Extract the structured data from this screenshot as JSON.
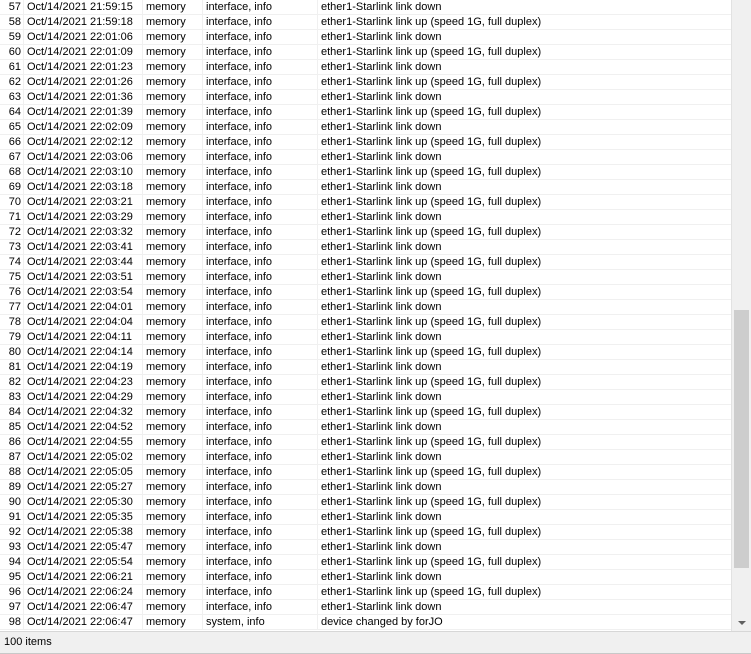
{
  "log": {
    "rows": [
      {
        "num": "57",
        "time": "Oct/14/2021 21:59:15",
        "buffer": "memory",
        "topics": "interface, info",
        "message": "ether1-Starlink link down"
      },
      {
        "num": "58",
        "time": "Oct/14/2021 21:59:18",
        "buffer": "memory",
        "topics": "interface, info",
        "message": "ether1-Starlink link up (speed 1G, full duplex)"
      },
      {
        "num": "59",
        "time": "Oct/14/2021 22:01:06",
        "buffer": "memory",
        "topics": "interface, info",
        "message": "ether1-Starlink link down"
      },
      {
        "num": "60",
        "time": "Oct/14/2021 22:01:09",
        "buffer": "memory",
        "topics": "interface, info",
        "message": "ether1-Starlink link up (speed 1G, full duplex)"
      },
      {
        "num": "61",
        "time": "Oct/14/2021 22:01:23",
        "buffer": "memory",
        "topics": "interface, info",
        "message": "ether1-Starlink link down"
      },
      {
        "num": "62",
        "time": "Oct/14/2021 22:01:26",
        "buffer": "memory",
        "topics": "interface, info",
        "message": "ether1-Starlink link up (speed 1G, full duplex)"
      },
      {
        "num": "63",
        "time": "Oct/14/2021 22:01:36",
        "buffer": "memory",
        "topics": "interface, info",
        "message": "ether1-Starlink link down"
      },
      {
        "num": "64",
        "time": "Oct/14/2021 22:01:39",
        "buffer": "memory",
        "topics": "interface, info",
        "message": "ether1-Starlink link up (speed 1G, full duplex)"
      },
      {
        "num": "65",
        "time": "Oct/14/2021 22:02:09",
        "buffer": "memory",
        "topics": "interface, info",
        "message": "ether1-Starlink link down"
      },
      {
        "num": "66",
        "time": "Oct/14/2021 22:02:12",
        "buffer": "memory",
        "topics": "interface, info",
        "message": "ether1-Starlink link up (speed 1G, full duplex)"
      },
      {
        "num": "67",
        "time": "Oct/14/2021 22:03:06",
        "buffer": "memory",
        "topics": "interface, info",
        "message": "ether1-Starlink link down"
      },
      {
        "num": "68",
        "time": "Oct/14/2021 22:03:10",
        "buffer": "memory",
        "topics": "interface, info",
        "message": "ether1-Starlink link up (speed 1G, full duplex)"
      },
      {
        "num": "69",
        "time": "Oct/14/2021 22:03:18",
        "buffer": "memory",
        "topics": "interface, info",
        "message": "ether1-Starlink link down"
      },
      {
        "num": "70",
        "time": "Oct/14/2021 22:03:21",
        "buffer": "memory",
        "topics": "interface, info",
        "message": "ether1-Starlink link up (speed 1G, full duplex)"
      },
      {
        "num": "71",
        "time": "Oct/14/2021 22:03:29",
        "buffer": "memory",
        "topics": "interface, info",
        "message": "ether1-Starlink link down"
      },
      {
        "num": "72",
        "time": "Oct/14/2021 22:03:32",
        "buffer": "memory",
        "topics": "interface, info",
        "message": "ether1-Starlink link up (speed 1G, full duplex)"
      },
      {
        "num": "73",
        "time": "Oct/14/2021 22:03:41",
        "buffer": "memory",
        "topics": "interface, info",
        "message": "ether1-Starlink link down"
      },
      {
        "num": "74",
        "time": "Oct/14/2021 22:03:44",
        "buffer": "memory",
        "topics": "interface, info",
        "message": "ether1-Starlink link up (speed 1G, full duplex)"
      },
      {
        "num": "75",
        "time": "Oct/14/2021 22:03:51",
        "buffer": "memory",
        "topics": "interface, info",
        "message": "ether1-Starlink link down"
      },
      {
        "num": "76",
        "time": "Oct/14/2021 22:03:54",
        "buffer": "memory",
        "topics": "interface, info",
        "message": "ether1-Starlink link up (speed 1G, full duplex)"
      },
      {
        "num": "77",
        "time": "Oct/14/2021 22:04:01",
        "buffer": "memory",
        "topics": "interface, info",
        "message": "ether1-Starlink link down"
      },
      {
        "num": "78",
        "time": "Oct/14/2021 22:04:04",
        "buffer": "memory",
        "topics": "interface, info",
        "message": "ether1-Starlink link up (speed 1G, full duplex)"
      },
      {
        "num": "79",
        "time": "Oct/14/2021 22:04:11",
        "buffer": "memory",
        "topics": "interface, info",
        "message": "ether1-Starlink link down"
      },
      {
        "num": "80",
        "time": "Oct/14/2021 22:04:14",
        "buffer": "memory",
        "topics": "interface, info",
        "message": "ether1-Starlink link up (speed 1G, full duplex)"
      },
      {
        "num": "81",
        "time": "Oct/14/2021 22:04:19",
        "buffer": "memory",
        "topics": "interface, info",
        "message": "ether1-Starlink link down"
      },
      {
        "num": "82",
        "time": "Oct/14/2021 22:04:23",
        "buffer": "memory",
        "topics": "interface, info",
        "message": "ether1-Starlink link up (speed 1G, full duplex)"
      },
      {
        "num": "83",
        "time": "Oct/14/2021 22:04:29",
        "buffer": "memory",
        "topics": "interface, info",
        "message": "ether1-Starlink link down"
      },
      {
        "num": "84",
        "time": "Oct/14/2021 22:04:32",
        "buffer": "memory",
        "topics": "interface, info",
        "message": "ether1-Starlink link up (speed 1G, full duplex)"
      },
      {
        "num": "85",
        "time": "Oct/14/2021 22:04:52",
        "buffer": "memory",
        "topics": "interface, info",
        "message": "ether1-Starlink link down"
      },
      {
        "num": "86",
        "time": "Oct/14/2021 22:04:55",
        "buffer": "memory",
        "topics": "interface, info",
        "message": "ether1-Starlink link up (speed 1G, full duplex)"
      },
      {
        "num": "87",
        "time": "Oct/14/2021 22:05:02",
        "buffer": "memory",
        "topics": "interface, info",
        "message": "ether1-Starlink link down"
      },
      {
        "num": "88",
        "time": "Oct/14/2021 22:05:05",
        "buffer": "memory",
        "topics": "interface, info",
        "message": "ether1-Starlink link up (speed 1G, full duplex)"
      },
      {
        "num": "89",
        "time": "Oct/14/2021 22:05:27",
        "buffer": "memory",
        "topics": "interface, info",
        "message": "ether1-Starlink link down"
      },
      {
        "num": "90",
        "time": "Oct/14/2021 22:05:30",
        "buffer": "memory",
        "topics": "interface, info",
        "message": "ether1-Starlink link up (speed 1G, full duplex)"
      },
      {
        "num": "91",
        "time": "Oct/14/2021 22:05:35",
        "buffer": "memory",
        "topics": "interface, info",
        "message": "ether1-Starlink link down"
      },
      {
        "num": "92",
        "time": "Oct/14/2021 22:05:38",
        "buffer": "memory",
        "topics": "interface, info",
        "message": "ether1-Starlink link up (speed 1G, full duplex)"
      },
      {
        "num": "93",
        "time": "Oct/14/2021 22:05:47",
        "buffer": "memory",
        "topics": "interface, info",
        "message": "ether1-Starlink link down"
      },
      {
        "num": "94",
        "time": "Oct/14/2021 22:05:54",
        "buffer": "memory",
        "topics": "interface, info",
        "message": "ether1-Starlink link up (speed 1G, full duplex)"
      },
      {
        "num": "95",
        "time": "Oct/14/2021 22:06:21",
        "buffer": "memory",
        "topics": "interface, info",
        "message": "ether1-Starlink link down"
      },
      {
        "num": "96",
        "time": "Oct/14/2021 22:06:24",
        "buffer": "memory",
        "topics": "interface, info",
        "message": "ether1-Starlink link up (speed 1G, full duplex)"
      },
      {
        "num": "97",
        "time": "Oct/14/2021 22:06:47",
        "buffer": "memory",
        "topics": "interface, info",
        "message": "ether1-Starlink link down"
      },
      {
        "num": "98",
        "time": "Oct/14/2021 22:06:47",
        "buffer": "memory",
        "topics": "system, info",
        "message": "device changed by forJO"
      }
    ]
  },
  "scrollbar": {
    "position_fraction": 0.87,
    "visible_fraction": 0.42
  },
  "status": {
    "item_count": "100 items"
  }
}
